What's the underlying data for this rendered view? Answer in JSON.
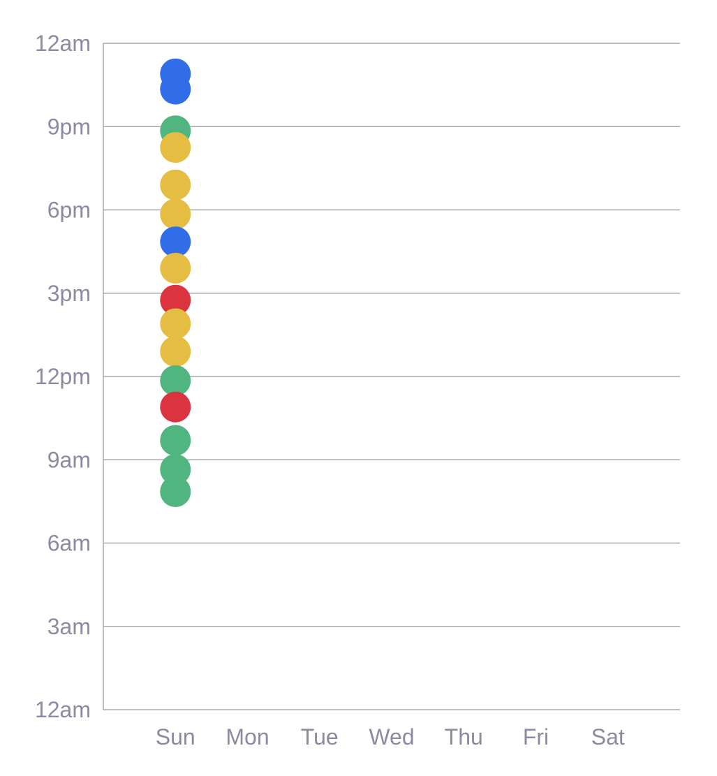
{
  "chart_data": {
    "type": "scatter",
    "title": "",
    "xlabel": "",
    "ylabel": "",
    "categories": [
      "Sun",
      "Mon",
      "Tue",
      "Wed",
      "Thu",
      "Fri",
      "Sat"
    ],
    "y_ticks": [
      "12am",
      "3am",
      "6am",
      "9am",
      "12pm",
      "3pm",
      "6pm",
      "9pm",
      "12am"
    ],
    "ylim": [
      0,
      24
    ],
    "y_unit": "hour of day",
    "grid": true,
    "colors": {
      "blue": "#316de8",
      "green": "#51b57f",
      "yellow": "#e4bd42",
      "red": "#dc343f"
    },
    "points": [
      {
        "day": "Sun",
        "hour": 22.9,
        "color": "blue"
      },
      {
        "day": "Sun",
        "hour": 22.35,
        "color": "blue"
      },
      {
        "day": "Sun",
        "hour": 20.85,
        "color": "green"
      },
      {
        "day": "Sun",
        "hour": 20.25,
        "color": "yellow"
      },
      {
        "day": "Sun",
        "hour": 18.9,
        "color": "yellow"
      },
      {
        "day": "Sun",
        "hour": 17.85,
        "color": "yellow"
      },
      {
        "day": "Sun",
        "hour": 16.85,
        "color": "blue"
      },
      {
        "day": "Sun",
        "hour": 15.9,
        "color": "yellow"
      },
      {
        "day": "Sun",
        "hour": 14.75,
        "color": "red"
      },
      {
        "day": "Sun",
        "hour": 13.9,
        "color": "yellow"
      },
      {
        "day": "Sun",
        "hour": 12.9,
        "color": "yellow"
      },
      {
        "day": "Sun",
        "hour": 11.85,
        "color": "green"
      },
      {
        "day": "Sun",
        "hour": 10.9,
        "color": "red"
      },
      {
        "day": "Sun",
        "hour": 9.7,
        "color": "green"
      },
      {
        "day": "Sun",
        "hour": 8.65,
        "color": "green"
      },
      {
        "day": "Sun",
        "hour": 7.85,
        "color": "green"
      }
    ]
  }
}
